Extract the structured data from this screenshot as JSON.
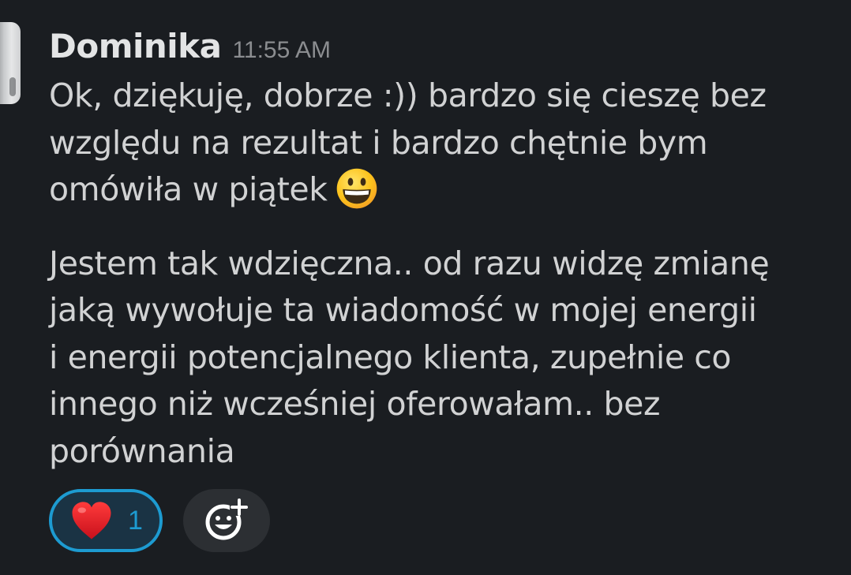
{
  "message": {
    "author": "Dominika",
    "timestamp": "11:55 AM",
    "paragraph1": {
      "line1": "Ok, dziękuję, dobrze :)) bardzo się cieszę bez",
      "line2": "względu na rezultat i bardzo chętnie bym",
      "line3": "omówiła w piątek",
      "emoji": "grinning-face-emoji"
    },
    "paragraph2": {
      "line1": "Jestem tak wdzięczna.. od razu widzę zmianę",
      "line2": "jaką wywołuje ta wiadomość w mojej energii",
      "line3": "i energii potencjalnego klienta, zupełnie co",
      "line4": "innego niż wcześniej oferowałam.. bez",
      "line5": "porównania"
    }
  },
  "reactions": [
    {
      "icon": "red-heart-icon",
      "count": "1",
      "selected": true
    }
  ],
  "add_reaction": {
    "icon": "add-emoji-icon"
  },
  "colors": {
    "background": "#1a1d21",
    "text": "#d1d2d3",
    "timestamp": "#8b8d90",
    "accent": "#1d9bd1",
    "heart": "#e0202a"
  }
}
